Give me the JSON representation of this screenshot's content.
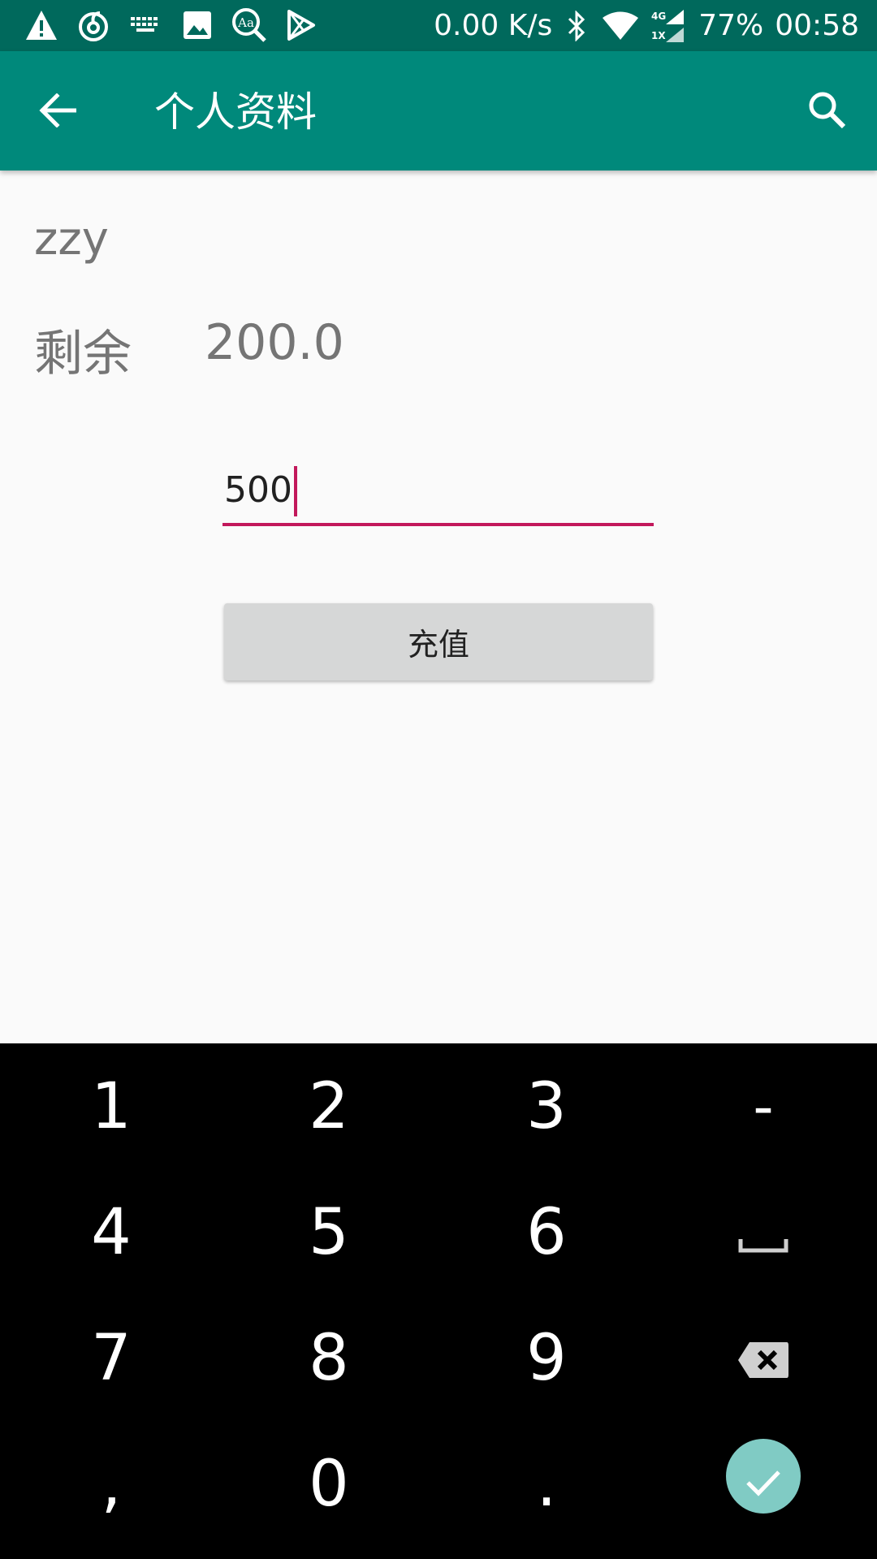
{
  "status_bar": {
    "net_speed": "0.00 K/s",
    "battery": "77%",
    "time": "00:58",
    "left_icons": [
      "warning-icon",
      "music-app-icon",
      "keyboard-icon",
      "image-icon",
      "dictionary-icon",
      "play-store-icon"
    ],
    "right_icons": [
      "bluetooth-icon",
      "wifi-icon",
      "cellular-signal-icon"
    ]
  },
  "app_bar": {
    "title": "个人资料",
    "back_icon": "arrow-back-icon",
    "search_icon": "search-icon",
    "color": "#00897b"
  },
  "profile": {
    "username": "zzy",
    "balance_label": "剩余",
    "balance_value": "200.0"
  },
  "recharge": {
    "amount_value": "500",
    "button_label": "充值",
    "accent_color": "#c2185b"
  },
  "keyboard": {
    "rows": [
      [
        "1",
        "2",
        "3",
        "-"
      ],
      [
        "4",
        "5",
        "6",
        "space"
      ],
      [
        "7",
        "8",
        "9",
        "backspace"
      ],
      [
        ",",
        "0",
        ".",
        "enter"
      ]
    ],
    "enter_color": "#80cbc4"
  }
}
